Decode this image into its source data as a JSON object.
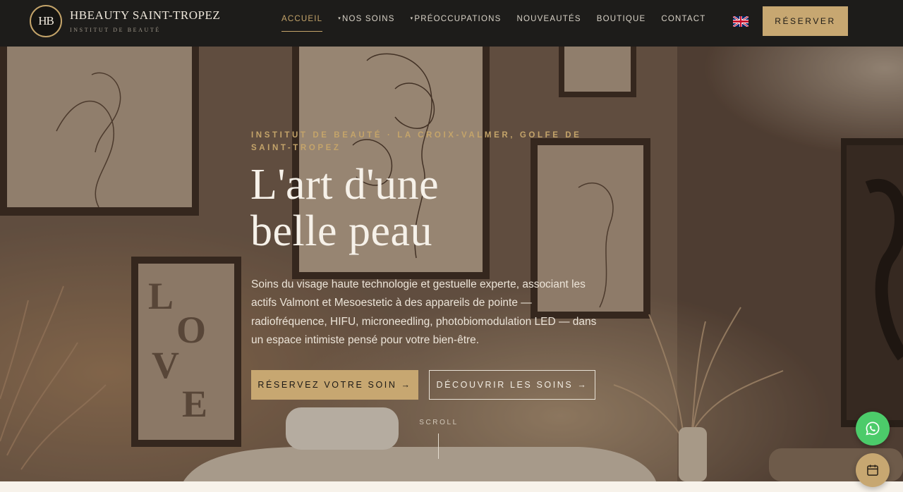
{
  "brand": {
    "monogram": "HB",
    "name": "HBEAUTY SAINT-TROPEZ",
    "tagline": "INSTITUT DE BEAUTÉ"
  },
  "nav": {
    "items": [
      {
        "label": "ACCUEIL",
        "active": true,
        "dropdown": false
      },
      {
        "label": "NOS SOINS",
        "active": false,
        "dropdown": true
      },
      {
        "label": "PRÉOCCUPATIONS",
        "active": false,
        "dropdown": true
      },
      {
        "label": "NOUVEAUTÉS",
        "active": false,
        "dropdown": false
      },
      {
        "label": "BOUTIQUE",
        "active": false,
        "dropdown": false
      },
      {
        "label": "CONTACT",
        "active": false,
        "dropdown": false
      }
    ],
    "language_icon": "uk-flag-icon",
    "cta_label": "RÉSERVER"
  },
  "hero": {
    "eyebrow": "INSTITUT DE BEAUTÉ · LA CROIX-VALMER, GOLFE DE SAINT-TROPEZ",
    "title_line1": "L'art d'une",
    "title_line2": "belle peau",
    "description": "Soins du visage haute technologie et gestuelle experte, associant les actifs Valmont et Mesoestetic à des appareils de pointe — radiofréquence, HIFU, microneedling, photobiomodulation LED — dans un espace intimiste pensé pour votre bien-être.",
    "primary_cta": "RÉSERVEZ VOTRE SOIN →",
    "secondary_cta": "DÉCOUVRIR LES SOINS →",
    "scroll_label": "SCROLL",
    "artwork_text": [
      "L",
      "O",
      "V",
      "E"
    ]
  },
  "floating": {
    "whatsapp_icon": "whatsapp-icon",
    "calendar_icon": "calendar-icon"
  },
  "colors": {
    "gold": "#c7a771",
    "header_bg": "#1d1c1a",
    "whatsapp_green": "#4ccb6a",
    "cream": "#f7f2ea"
  }
}
